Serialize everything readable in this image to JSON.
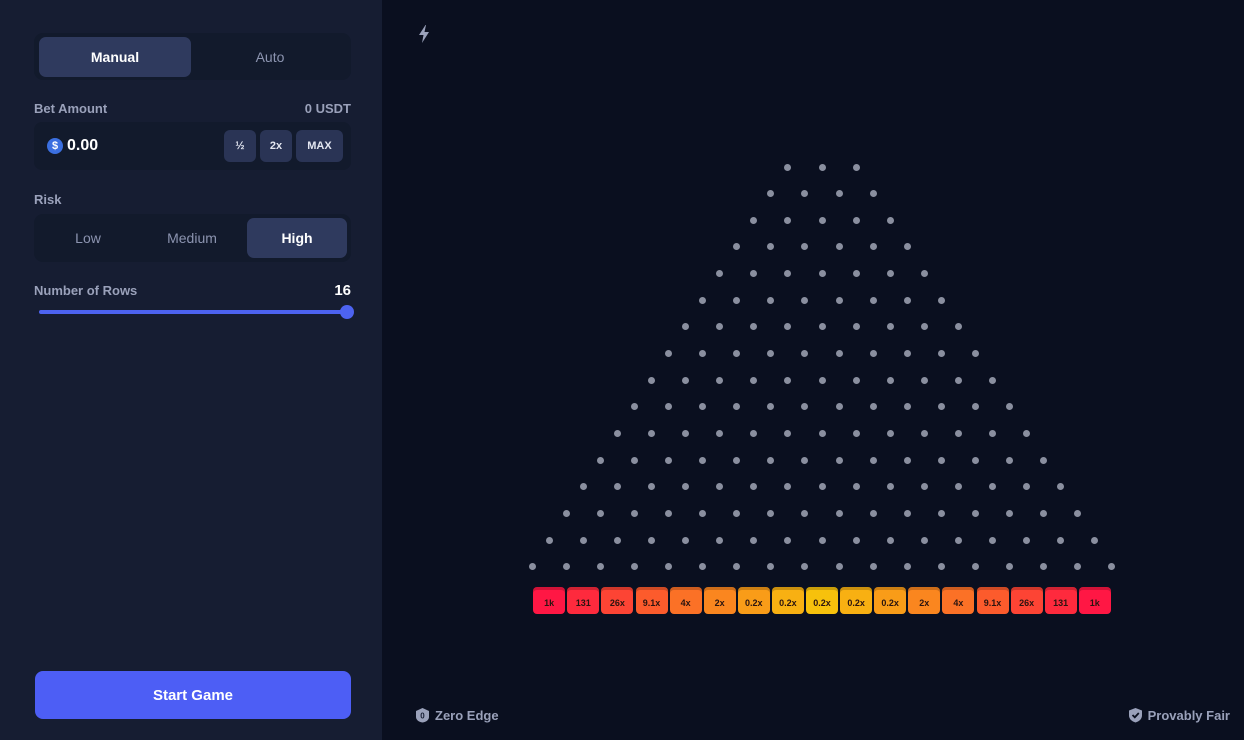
{
  "sidebar": {
    "mode_tabs": {
      "manual": "Manual",
      "auto": "Auto"
    },
    "bet": {
      "label": "Bet Amount",
      "balance": "0 USDT",
      "currency_icon": "$",
      "value": "0.00",
      "half": "½",
      "double": "2x",
      "max": "MAX"
    },
    "risk": {
      "label": "Risk",
      "options": [
        "Low",
        "Medium",
        "High"
      ],
      "selected": "High"
    },
    "rows": {
      "label": "Number of Rows",
      "value": "16",
      "slider_fraction": 1.0
    },
    "start_label": "Start Game"
  },
  "board": {
    "rows": 16,
    "top_row_pegs": 3,
    "multipliers": [
      "1k",
      "131",
      "26x",
      "9.1x",
      "4x",
      "2x",
      "0.2x",
      "0.2x",
      "0.2x",
      "0.2x",
      "0.2x",
      "2x",
      "4x",
      "9.1x",
      "26x",
      "131",
      "1k"
    ],
    "bucket_colors": [
      "#ff1744",
      "#fe2a3d",
      "#fd4434",
      "#fc5b2c",
      "#fb7126",
      "#fa861f",
      "#f99c18",
      "#f8b012",
      "#f7c10c",
      "#f8b012",
      "#f99c18",
      "#fa861f",
      "#fb7126",
      "#fc5b2c",
      "#fd4434",
      "#fe2a3d",
      "#ff1744"
    ],
    "peg_color": "#8a8f9f"
  },
  "footer": {
    "zero_edge": "Zero Edge",
    "provably_fair": "Provably Fair"
  },
  "icons": [
    "bolt-icon",
    "zero-edge-icon",
    "shield-check-icon",
    "coin-icon"
  ]
}
